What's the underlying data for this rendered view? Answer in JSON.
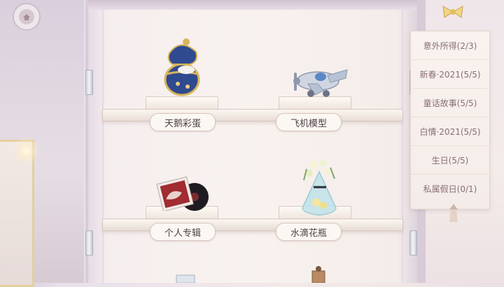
{
  "shelf_items": [
    {
      "label": "天鹅彩蛋"
    },
    {
      "label": "飞机模型"
    },
    {
      "label": "个人专辑"
    },
    {
      "label": "水滴花瓶"
    }
  ],
  "categories": [
    {
      "label": "意外所得(2/3)"
    },
    {
      "label": "新春·2021(5/5)"
    },
    {
      "label": "童话故事(5/5)"
    },
    {
      "label": "白情·2021(5/5)"
    },
    {
      "label": "生日(5/5)"
    },
    {
      "label": "私属假日(0/1)"
    }
  ],
  "colors": {
    "label_text": "#4e4247",
    "category_text": "#8a6f76",
    "gold_accent": "#e4cf9d"
  }
}
